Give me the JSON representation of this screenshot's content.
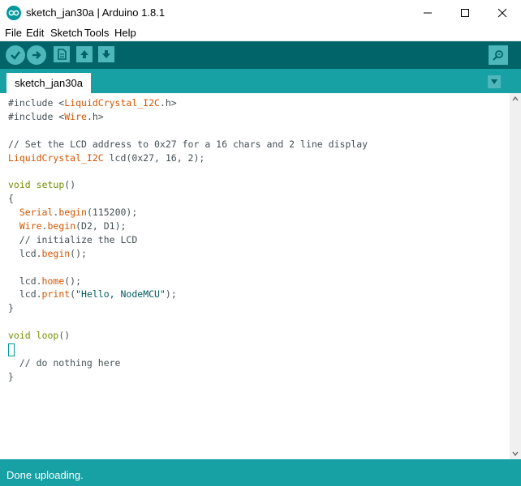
{
  "window": {
    "title": "sketch_jan30a | Arduino 1.8.1"
  },
  "menu": {
    "items": [
      "File",
      "Edit",
      "Sketch",
      "Tools",
      "Help"
    ]
  },
  "toolbar": {
    "icons": [
      "verify-icon",
      "upload-icon",
      "new-icon",
      "open-icon",
      "save-icon",
      "serial-monitor-icon"
    ]
  },
  "tabs": {
    "active": "sketch_jan30a"
  },
  "editor": {
    "lines": [
      "#include <LiquidCrystal_I2C.h>",
      "#include <Wire.h>",
      "",
      "// Set the LCD address to 0x27 for a 16 chars and 2 line display",
      "LiquidCrystal_I2C lcd(0x27, 16, 2);",
      "",
      "void setup()",
      "{",
      "  Serial.begin(115200);",
      "  Wire.begin(D2, D1);",
      "  // initialize the LCD",
      "  lcd.begin();",
      "",
      "  lcd.home();",
      "  lcd.print(\"Hello, NodeMCU\");",
      "}",
      "",
      "void loop()",
      "{",
      "  // do nothing here",
      "}"
    ]
  },
  "status": {
    "message": "Done uploading."
  },
  "colors": {
    "toolbar": "#006468",
    "tabstrip": "#17a1a5",
    "button": "#4db7bb",
    "keyword": "#728e00",
    "function": "#d35400",
    "string": "#005c5f"
  }
}
